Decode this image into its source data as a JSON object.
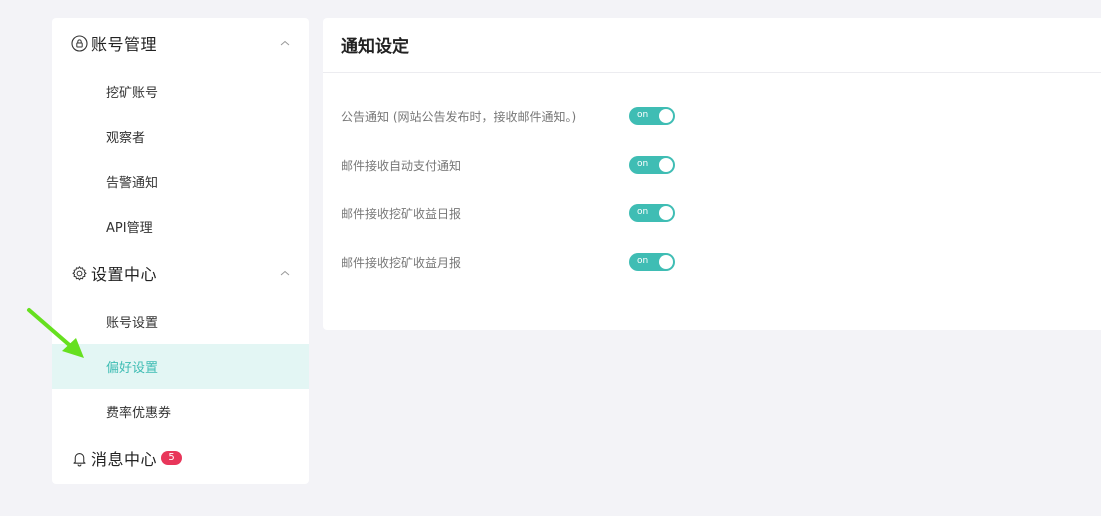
{
  "sidebar": {
    "groups": [
      {
        "title": "账号管理",
        "icon": "lock-circle-icon",
        "items": [
          "挖矿账号",
          "观察者",
          "告警通知",
          "API管理"
        ]
      },
      {
        "title": "设置中心",
        "icon": "gear-icon",
        "items": [
          "账号设置",
          "偏好设置",
          "费率优惠券"
        ]
      }
    ],
    "message_center": {
      "title": "消息中心",
      "icon": "bell-icon",
      "badge": "5"
    },
    "active_item": "偏好设置"
  },
  "main": {
    "title": "通知设定",
    "settings": [
      {
        "label": "公告通知 (网站公告发布时，接收邮件通知。)",
        "toggle": "on",
        "enabled": true
      },
      {
        "label": "邮件接收自动支付通知",
        "toggle": "on",
        "enabled": true
      },
      {
        "label": "邮件接收挖矿收益日报",
        "toggle": "on",
        "enabled": true
      },
      {
        "label": "邮件接收挖矿收益月报",
        "toggle": "on",
        "enabled": true
      }
    ]
  },
  "colors": {
    "accent": "#3fbdb4",
    "active_bg": "#e3f6f4",
    "badge": "#e8365a",
    "annotation_arrow": "#66e01f"
  }
}
